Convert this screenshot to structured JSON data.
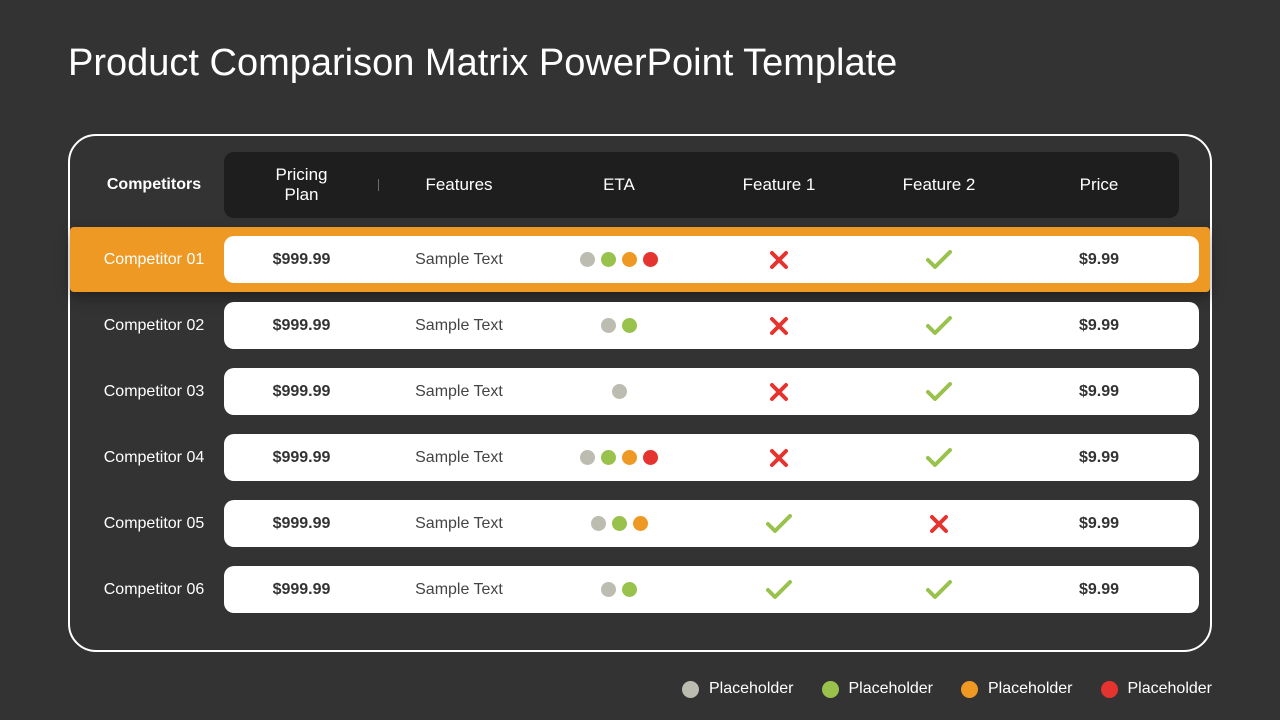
{
  "title": "Product Comparison Matrix PowerPoint Template",
  "headers": {
    "competitors": "Competitors",
    "cols": [
      "Pricing\nPlan",
      "Features",
      "ETA",
      "Feature 1",
      "Feature 2",
      "Price"
    ]
  },
  "dot_colors": {
    "gray": "#bcbcb1",
    "green": "#99c24d",
    "orange": "#ef9925",
    "red": "#e5342f"
  },
  "rows": [
    {
      "label": "Competitor 01",
      "highlight": true,
      "pricing": "$999.99",
      "features": "Sample Text",
      "eta": [
        "gray",
        "green",
        "orange",
        "red"
      ],
      "f1": "cross",
      "f2": "check",
      "price": "$9.99"
    },
    {
      "label": "Competitor 02",
      "highlight": false,
      "pricing": "$999.99",
      "features": "Sample Text",
      "eta": [
        "gray",
        "green"
      ],
      "f1": "cross",
      "f2": "check",
      "price": "$9.99"
    },
    {
      "label": "Competitor 03",
      "highlight": false,
      "pricing": "$999.99",
      "features": "Sample Text",
      "eta": [
        "gray"
      ],
      "f1": "cross",
      "f2": "check",
      "price": "$9.99"
    },
    {
      "label": "Competitor 04",
      "highlight": false,
      "pricing": "$999.99",
      "features": "Sample Text",
      "eta": [
        "gray",
        "green",
        "orange",
        "red"
      ],
      "f1": "cross",
      "f2": "check",
      "price": "$9.99"
    },
    {
      "label": "Competitor 05",
      "highlight": false,
      "pricing": "$999.99",
      "features": "Sample Text",
      "eta": [
        "gray",
        "green",
        "orange"
      ],
      "f1": "check",
      "f2": "cross",
      "price": "$9.99"
    },
    {
      "label": "Competitor 06",
      "highlight": false,
      "pricing": "$999.99",
      "features": "Sample Text",
      "eta": [
        "gray",
        "green"
      ],
      "f1": "check",
      "f2": "check",
      "price": "$9.99"
    }
  ],
  "legend": [
    {
      "color": "gray",
      "label": "Placeholder"
    },
    {
      "color": "green",
      "label": "Placeholder"
    },
    {
      "color": "orange",
      "label": "Placeholder"
    },
    {
      "color": "red",
      "label": "Placeholder"
    }
  ]
}
